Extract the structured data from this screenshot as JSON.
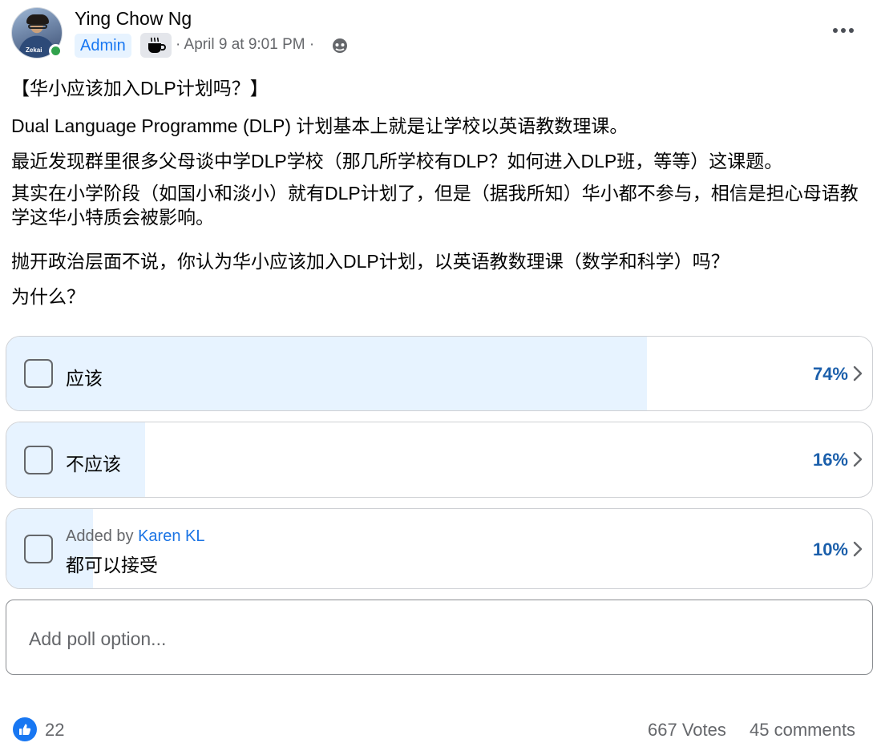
{
  "post": {
    "author_name": "Ying Chow Ng",
    "admin_label": "Admin",
    "meta_text": "· April 9 at 9:01 PM ·",
    "avatar_text": "Zekai",
    "title_line": "【华小应该加入DLP计划吗？】",
    "line1": "Dual Language Programme (DLP) 计划基本上就是让学校以英语教数理课。",
    "line2": "最近发现群里很多父母谈中学DLP学校（那几所学校有DLP？如何进入DLP班，等等）这课题。",
    "para3": "其实在小学阶段（如国小和淡小）就有DLP计划了，但是（据我所知）华小都不参与，相信是担心母语教学这华小特质会被影响。",
    "line4": "抛开政治层面不说，你认为华小应该加入DLP计划，以英语教数理课（数学和科学）吗？",
    "line5": "为什么？"
  },
  "poll": {
    "options": [
      {
        "label": "应该",
        "percent_text": "74%",
        "share": 0.74
      },
      {
        "label": "不应该",
        "percent_text": "16%",
        "share": 0.16
      },
      {
        "added_prefix": "Added by",
        "added_by": "Karen KL",
        "label": "都可以接受",
        "percent_text": "10%",
        "share": 0.1
      }
    ],
    "add_option_placeholder": "Add poll option..."
  },
  "footer": {
    "like_count": "22",
    "votes_text": "667 Votes",
    "comments_text": "45 comments"
  },
  "colors": {
    "accent": "#1877f2",
    "fill": "#e7f3ff",
    "percent": "#1b5fab",
    "online": "#31a24c"
  },
  "icons": [
    "online-status-icon",
    "coffee-cup-icon",
    "globe-icon",
    "more-options-icon",
    "chevron-right-icon",
    "like-icon"
  ]
}
